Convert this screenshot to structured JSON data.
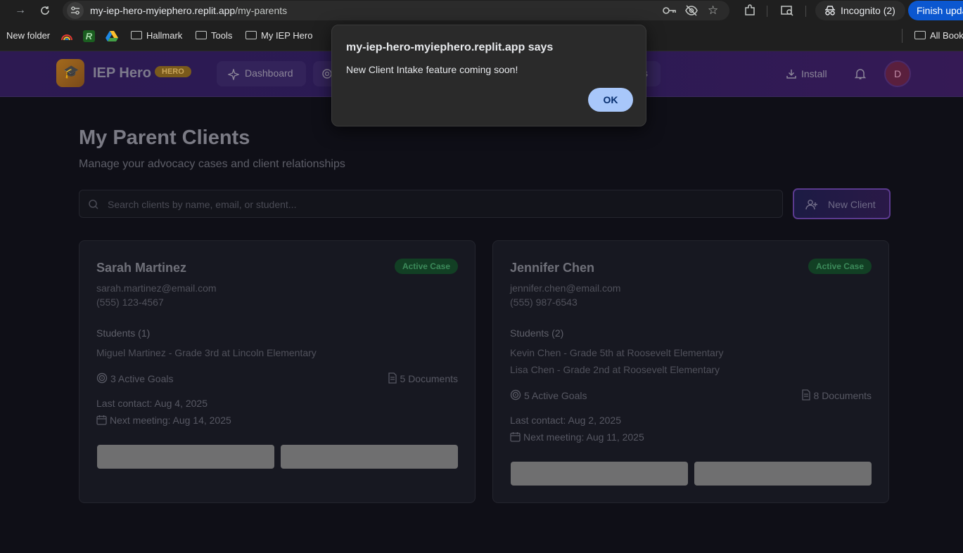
{
  "browser": {
    "url_host": "my-iep-hero-myiephero.replit.app",
    "url_path": "/my-parents",
    "incognito_label": "Incognito (2)",
    "finish_update_label": "Finish upda"
  },
  "bookmarks": {
    "items": [
      "New folder",
      "Hallmark",
      "Tools",
      "My IEP Hero"
    ],
    "all_bookmarks": "All Book"
  },
  "app": {
    "brand": "IEP Hero",
    "badge": "HERO",
    "nav": [
      "Dashboard"
    ],
    "install_label": "Install",
    "avatar_initial": "D"
  },
  "page": {
    "title": "My Parent Clients",
    "subtitle": "Manage your advocacy cases and client relationships",
    "search_placeholder": "Search clients by name, email, or student...",
    "new_client_label": "New Client"
  },
  "clients": [
    {
      "name": "Sarah Martinez",
      "status": "Active Case",
      "email": "sarah.martinez@email.com",
      "phone": "(555) 123-4567",
      "students_label": "Students (1)",
      "students": [
        "Miguel Martinez - Grade 3rd at Lincoln Elementary"
      ],
      "goals": "3 Active Goals",
      "documents": "5 Documents",
      "last_contact": "Last contact: Aug 4, 2025",
      "next_meeting": "Next meeting: Aug 14, 2025"
    },
    {
      "name": "Jennifer Chen",
      "status": "Active Case",
      "email": "jennifer.chen@email.com",
      "phone": "(555) 987-6543",
      "students_label": "Students (2)",
      "students": [
        "Kevin Chen - Grade 5th at Roosevelt Elementary",
        "Lisa Chen - Grade 2nd at Roosevelt Elementary"
      ],
      "goals": "5 Active Goals",
      "documents": "8 Documents",
      "last_contact": "Last contact: Aug 2, 2025",
      "next_meeting": "Next meeting: Aug 11, 2025"
    }
  ],
  "dialog": {
    "title": "my-iep-hero-myiephero.replit.app says",
    "message": "New Client Intake feature coming soon!",
    "ok_label": "OK"
  }
}
